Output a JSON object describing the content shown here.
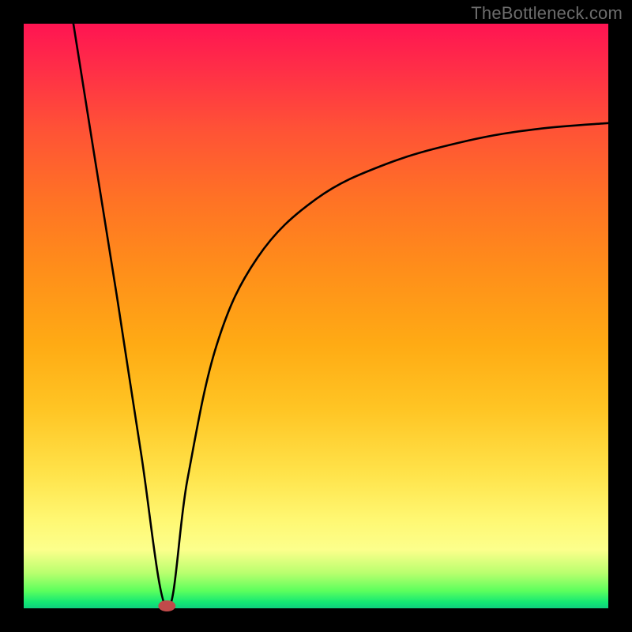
{
  "watermark": "TheBottleneck.com",
  "chart_data": {
    "type": "line",
    "title": "",
    "xlabel": "",
    "ylabel": "",
    "xlim": [
      0,
      100
    ],
    "ylim": [
      0,
      100
    ],
    "min_point": {
      "x": 24.5,
      "y": 0
    },
    "curve": {
      "left_start": {
        "x": 8.5,
        "y": 100
      },
      "descend_to": {
        "x": 24.5,
        "y": 0
      },
      "right_end": {
        "x": 100,
        "y": 83
      },
      "right_shape": "concave-decelerating"
    },
    "series": [
      {
        "name": "bottleneck",
        "x": [
          8.5,
          12,
          16,
          20,
          24.5,
          28,
          33,
          40,
          50,
          62,
          76,
          88,
          100
        ],
        "y": [
          100,
          78,
          53,
          27,
          0,
          22,
          45,
          60,
          70,
          76,
          80,
          82,
          83
        ]
      }
    ],
    "gradient_bands": [
      {
        "color": "#ff1452",
        "stop": 0
      },
      {
        "color": "#ff8e1a",
        "stop": 42
      },
      {
        "color": "#ffe34a",
        "stop": 77
      },
      {
        "color": "#12e874",
        "stop": 99
      }
    ]
  }
}
